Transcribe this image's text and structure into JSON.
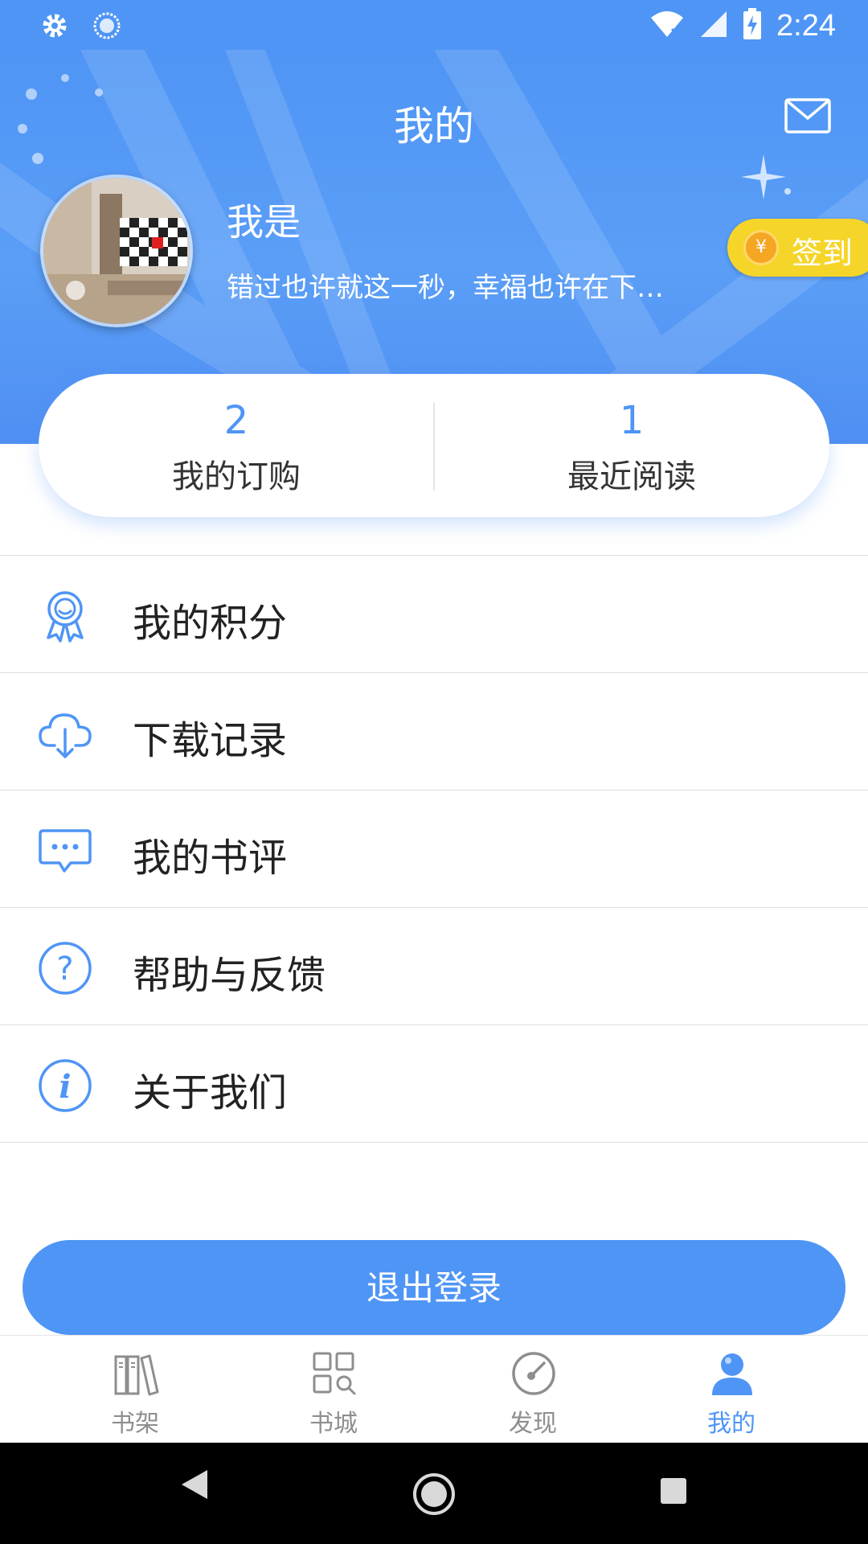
{
  "status_bar": {
    "time": "2:24"
  },
  "header": {
    "title": "我的",
    "username": "我是",
    "signature": "错过也许就这一秒，幸福也许在下…",
    "checkin_label": "签到",
    "coin_symbol": "¥"
  },
  "stats": [
    {
      "value": "2",
      "label": "我的订购"
    },
    {
      "value": "1",
      "label": "最近阅读"
    }
  ],
  "menu": [
    {
      "label": "我的积分",
      "icon": "award-icon"
    },
    {
      "label": "下载记录",
      "icon": "cloud-download-icon"
    },
    {
      "label": "我的书评",
      "icon": "comment-icon"
    },
    {
      "label": "帮助与反馈",
      "icon": "help-icon"
    },
    {
      "label": "关于我们",
      "icon": "info-icon"
    }
  ],
  "logout_label": "退出登录",
  "tabs": [
    {
      "label": "书架",
      "icon": "bookshelf-icon",
      "active": false
    },
    {
      "label": "书城",
      "icon": "bookstore-icon",
      "active": false
    },
    {
      "label": "发现",
      "icon": "discover-icon",
      "active": false
    },
    {
      "label": "我的",
      "icon": "profile-icon",
      "active": true
    }
  ],
  "colors": {
    "primary": "#4f95f5",
    "checkin": "#f6d52a",
    "text": "#222222",
    "inactive": "#8e8e8e"
  }
}
